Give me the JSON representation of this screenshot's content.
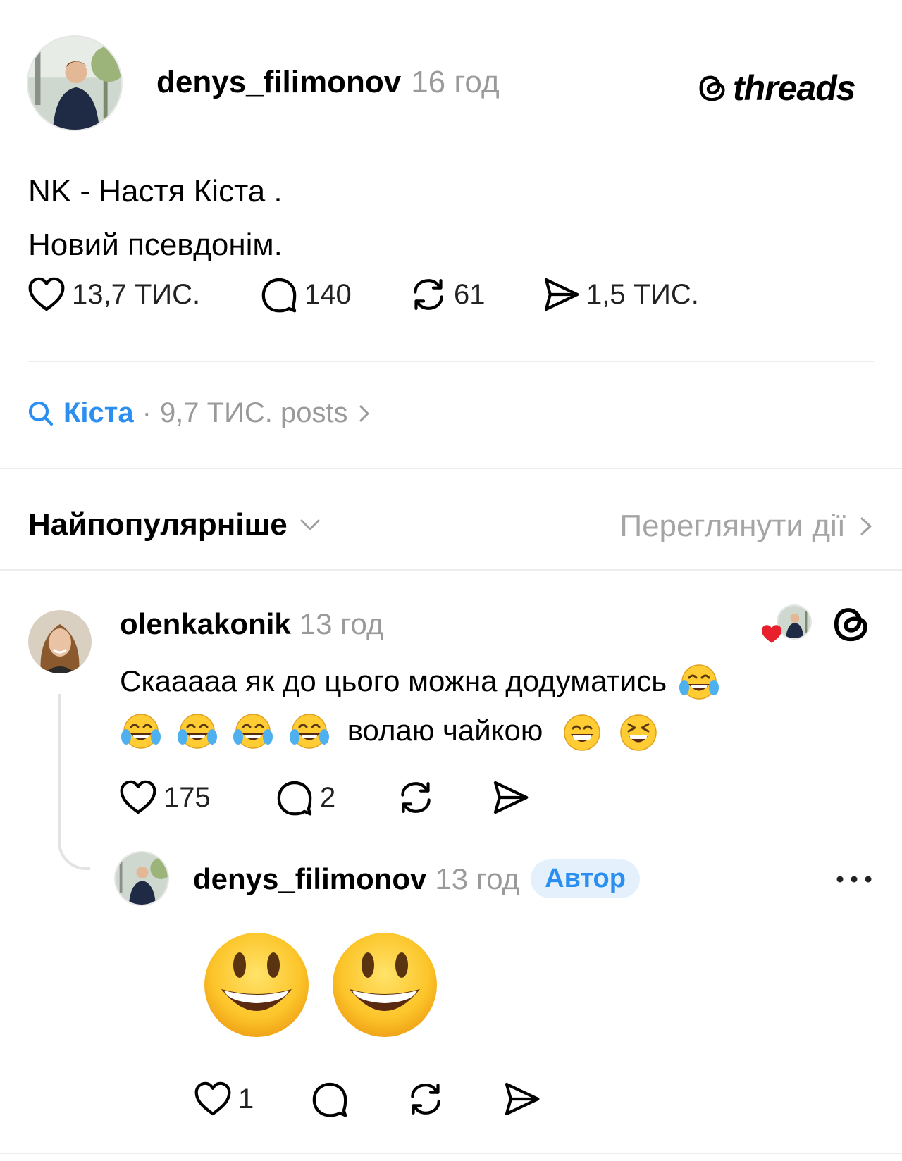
{
  "post": {
    "author": "denys_filimonov",
    "time": "16 год",
    "brand": "threads",
    "text_line1": "NK - Настя Кіста .",
    "text_line2": "Новий псевдонім.",
    "likes": "13,7 ТИС.",
    "comments": "140",
    "reposts": "61",
    "shares": "1,5 ТИС."
  },
  "topic": {
    "name": "Кіста",
    "separator": "·",
    "count": "9,7 ТИС. posts"
  },
  "replies_header": {
    "sort_label": "Найпопулярніше",
    "view_activity": "Переглянути дії"
  },
  "reply1": {
    "author": "olenkakonik",
    "time": "13 год",
    "text_part1": "Скааааа як до цього можна додуматись",
    "text_part2": "волаю чайкою",
    "likes": "175",
    "comments": "2"
  },
  "reply2": {
    "author": "denys_filimonov",
    "time": "13 год",
    "badge": "Автор",
    "likes": "1"
  },
  "colors": {
    "accent": "#2a8ff0",
    "muted": "#9a9a9a",
    "divider": "#ececec",
    "badge_bg": "#e4f1fd",
    "like_red": "#e8202c"
  },
  "icons": [
    "threads-logo-icon",
    "heart-icon",
    "comment-icon",
    "repost-icon",
    "share-icon",
    "search-icon",
    "chevron-right-icon",
    "chevron-down-icon",
    "more-icon",
    "tears-of-joy-emoji",
    "grinning-emoji",
    "laughing-emoji",
    "smiley-emoji"
  ]
}
